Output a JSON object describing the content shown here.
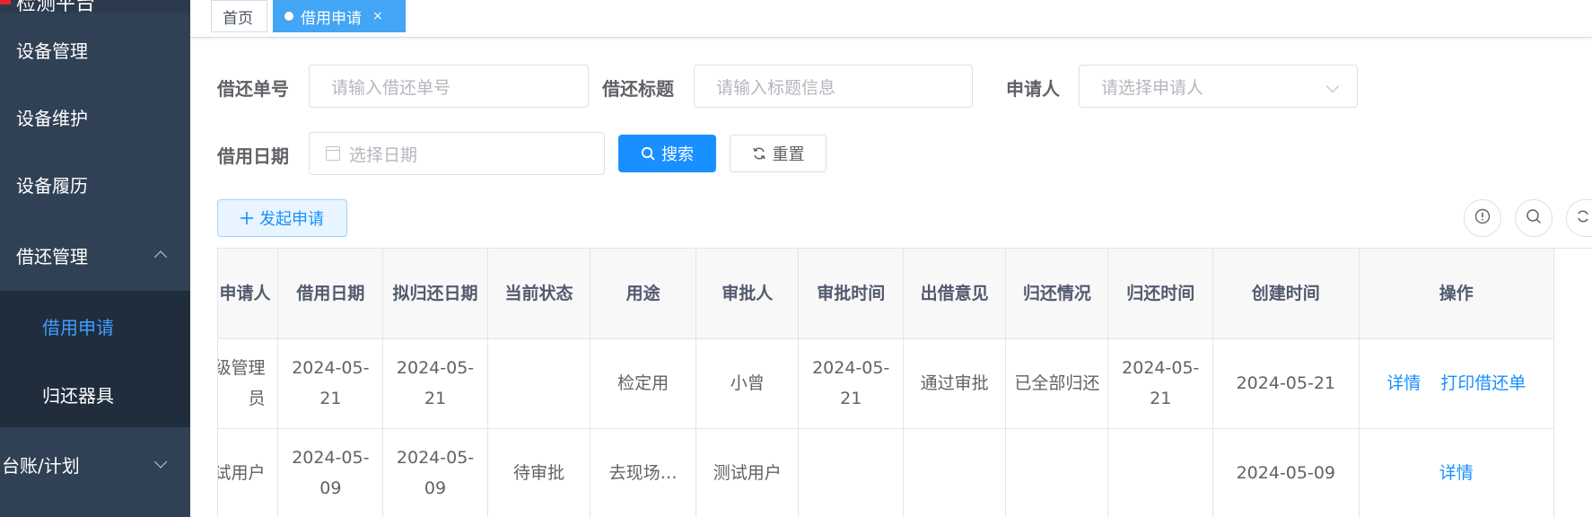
{
  "sidebar": {
    "logo_text": "检测平台",
    "items": [
      {
        "label": "设备管理"
      },
      {
        "label": "设备维护"
      },
      {
        "label": "设备履历"
      },
      {
        "label": "借还管理"
      },
      {
        "label": "台账/计划"
      }
    ],
    "submenu": [
      {
        "label": "借用申请"
      },
      {
        "label": "归还器具"
      }
    ]
  },
  "tabs": [
    {
      "label": "首页"
    },
    {
      "label": "借用申请",
      "close": "×"
    }
  ],
  "filters": {
    "code_label": "借还单号",
    "code_placeholder": "请输入借还单号",
    "title_label": "借还标题",
    "title_placeholder": "请输入标题信息",
    "applicant_label": "申请人",
    "applicant_placeholder": "请选择申请人",
    "date_label": "借用日期",
    "date_placeholder": "选择日期",
    "search_label": "搜索",
    "reset_label": "重置"
  },
  "toolbar": {
    "add_label": "发起申请"
  },
  "table": {
    "headers": [
      "申请人",
      "借用日期",
      "拟归还日期",
      "当前状态",
      "用途",
      "审批人",
      "审批时间",
      "出借意见",
      "归还情况",
      "归还时间",
      "创建时间",
      "操作"
    ],
    "rows": [
      {
        "applicant": "超级管理员",
        "borrow_date": "2024-05-21",
        "return_plan": "2024-05-21",
        "status": "",
        "purpose": "检定用",
        "approver": "小曾",
        "approve_time": "2024-05-21",
        "opinion": "通过审批",
        "return_status": "已全部归还",
        "return_time": "2024-05-21",
        "created": "2024-05-21",
        "actions": [
          "详情",
          "打印借还单"
        ]
      },
      {
        "applicant": "测试用户",
        "borrow_date": "2024-05-09",
        "return_plan": "2024-05-09",
        "status": "待审批",
        "purpose": "去现场…",
        "approver": "测试用户",
        "approve_time": "",
        "opinion": "",
        "return_status": "",
        "return_time": "",
        "created": "2024-05-09",
        "actions": [
          "详情"
        ]
      }
    ]
  },
  "colors": {
    "sidebar_bg": "#304156",
    "submenu_bg": "#1f2d3d",
    "accent": "#1890ff",
    "active_menu_text": "#409eff"
  }
}
